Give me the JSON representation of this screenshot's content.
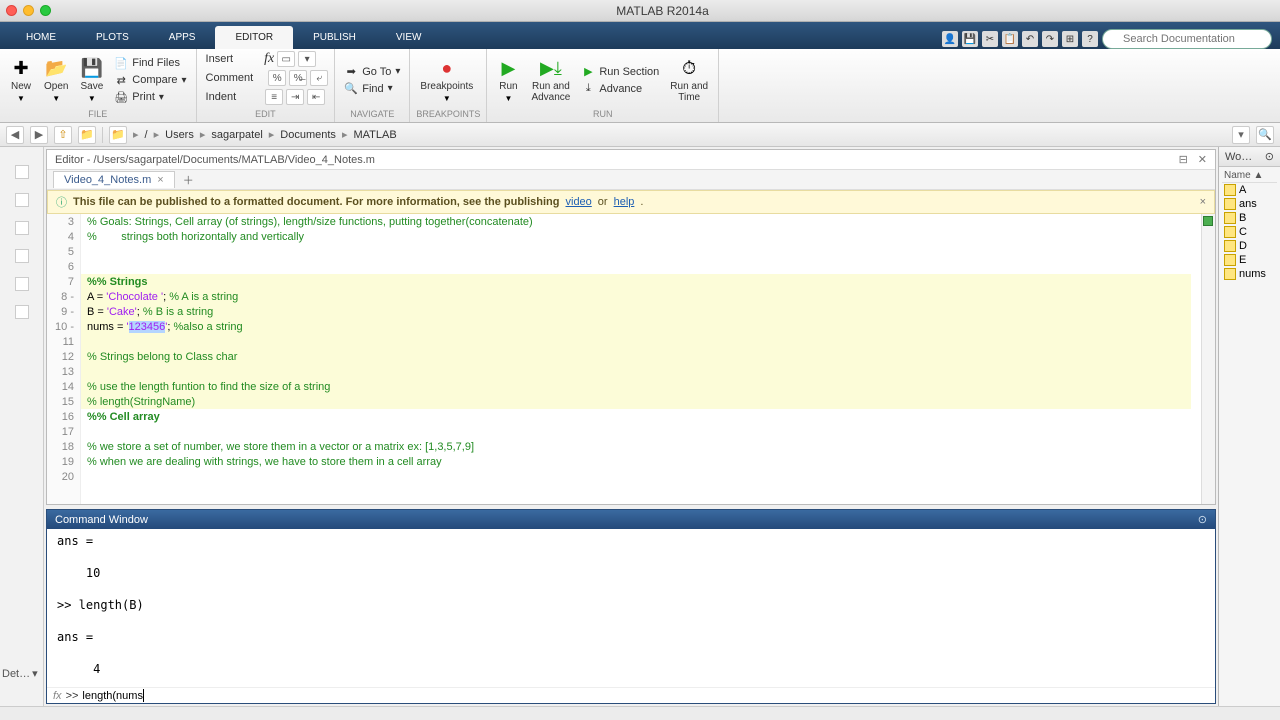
{
  "window": {
    "title": "MATLAB R2014a"
  },
  "tabs": {
    "items": [
      "HOME",
      "PLOTS",
      "APPS",
      "EDITOR",
      "PUBLISH",
      "VIEW"
    ],
    "active": 3
  },
  "search": {
    "placeholder": "Search Documentation"
  },
  "ribbon": {
    "file": {
      "new": "New",
      "open": "Open",
      "save": "Save",
      "find_files": "Find Files",
      "compare": "Compare",
      "print": "Print",
      "label": "FILE"
    },
    "edit": {
      "insert": "Insert",
      "comment": "Comment",
      "indent": "Indent",
      "label": "EDIT"
    },
    "navigate": {
      "goto": "Go To",
      "find": "Find",
      "label": "NAVIGATE"
    },
    "breakpoints": {
      "btn": "Breakpoints",
      "label": "BREAKPOINTS"
    },
    "run": {
      "run": "Run",
      "run_and_advance": "Run and\nAdvance",
      "run_section": "Run Section",
      "advance": "Advance",
      "run_and_time": "Run and\nTime",
      "label": "RUN"
    }
  },
  "path": {
    "segments": [
      "/",
      "Users",
      "sagarpatel",
      "Documents",
      "MATLAB"
    ]
  },
  "editor": {
    "title": "Editor - /Users/sagarpatel/Documents/MATLAB/Video_4_Notes.m",
    "tab": "Video_4_Notes.m",
    "publish_notice_pre": "This file can be published to a formatted document. For more information, see the publishing ",
    "publish_video": "video",
    "publish_or": " or ",
    "publish_help": "help",
    "publish_end": ".",
    "lines": [
      {
        "n": "3",
        "html": "<span class='cmt'>% Goals: Strings, Cell array (of strings), length/size functions, putting together(concatenate)</span>"
      },
      {
        "n": "4",
        "html": "<span class='cmt'>%        strings both horizontally and vertically</span>"
      },
      {
        "n": "5",
        "html": ""
      },
      {
        "n": "6",
        "html": ""
      },
      {
        "n": "7",
        "html": "<span class='sect'>%% Strings</span>",
        "hl": true
      },
      {
        "n": "8 -",
        "html": "A = <span class='str'>'Chocolate '</span>; <span class='cmt'>% A is a string</span>",
        "hl": true
      },
      {
        "n": "9 -",
        "html": "B = <span class='str'>'Cake'</span>; <span class='cmt'>% B is a string</span>",
        "hl": true
      },
      {
        "n": "10 -",
        "html": "nums = <span class='str'>'<span class='sel'>123456</span>'</span>; <span class='cmt'>%also a string</span>",
        "hl": true
      },
      {
        "n": "11",
        "html": "",
        "hl": true
      },
      {
        "n": "12",
        "html": "<span class='cmt'>% Strings belong to Class char</span>",
        "hl": true
      },
      {
        "n": "13",
        "html": "",
        "hl": true
      },
      {
        "n": "14",
        "html": "<span class='cmt'>% use the length funtion to find the size of a string</span>",
        "hl": true
      },
      {
        "n": "15",
        "html": "<span class='cmt'>% length(StringName)</span>",
        "hl": true
      },
      {
        "n": "16",
        "html": "<span class='sect'>%% Cell array</span>"
      },
      {
        "n": "17",
        "html": ""
      },
      {
        "n": "18",
        "html": "<span class='cmt'>% we store a set of number, we store them in a vector or a matrix ex: [1,3,5,7,9]</span>"
      },
      {
        "n": "19",
        "html": "<span class='cmt'>% when we are dealing with strings, we have to store them in a cell array</span>"
      },
      {
        "n": "20",
        "html": ""
      }
    ]
  },
  "command_window": {
    "title": "Command Window",
    "output": "ans =\n\n    10\n\n>> length(B)\n\nans =\n\n     4\n",
    "input": "length(nums"
  },
  "workspace": {
    "title": "Wo…",
    "header": "Name ▲",
    "vars": [
      "A",
      "ans",
      "B",
      "C",
      "D",
      "E",
      "nums"
    ]
  },
  "details_label": "Det…"
}
